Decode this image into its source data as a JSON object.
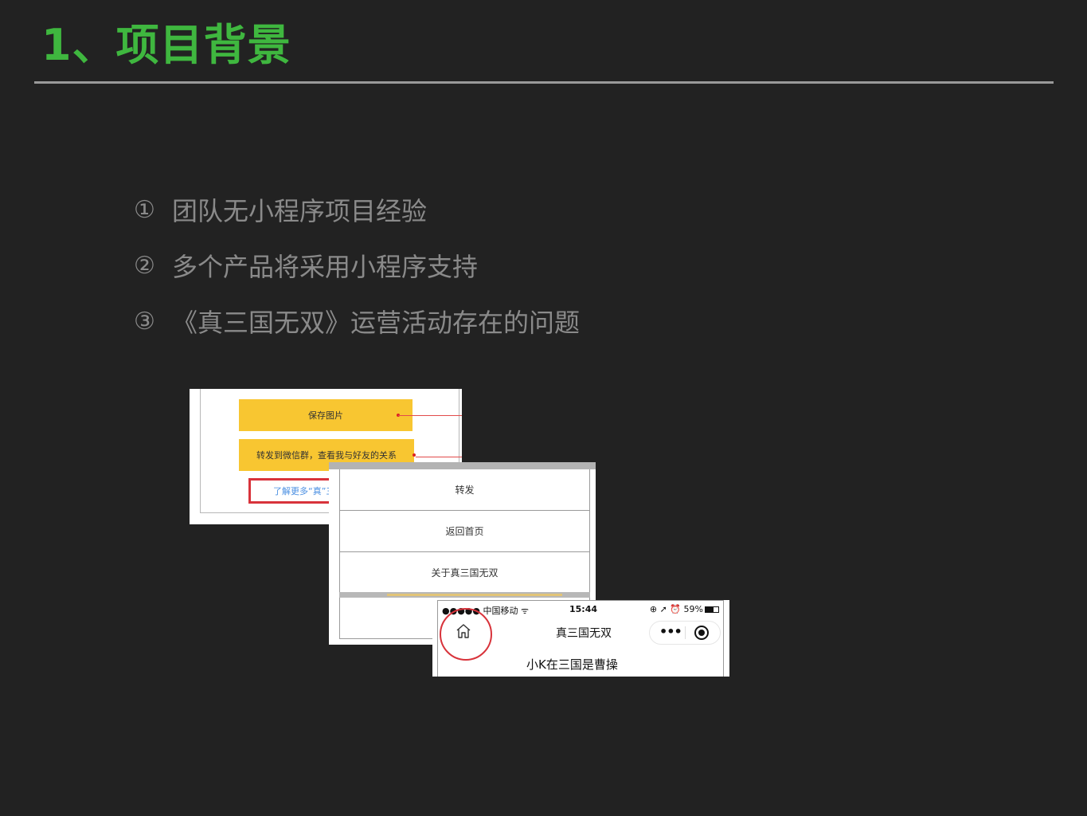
{
  "slide": {
    "title": "1、项目背景",
    "bullets": [
      {
        "num": "①",
        "text": "团队无小程序项目经验"
      },
      {
        "num": "②",
        "text": "多个产品将采用小程序支持"
      },
      {
        "num": "③",
        "text": "《真三国无双》运营活动存在的问题"
      }
    ]
  },
  "screenshot1": {
    "save_image": "保存图片",
    "share_group": "转发到微信群，查看我与好友的关系",
    "learn_more": "了解更多“真”三"
  },
  "screenshot2": {
    "menu": [
      "转发",
      "返回首页",
      "关于真三国无双"
    ]
  },
  "screenshot3": {
    "carrier": "●●●●● 中国移动 ᯤ",
    "time": "15:44",
    "status_right": "⊕ ➚ ⏰ 59%",
    "nav_title": "真三国无双",
    "page_heading": "小K在三国是曹操"
  },
  "colors": {
    "background": "#222222",
    "title_green": "#3fb73f",
    "bullet_gray": "#8a8a8a",
    "button_yellow": "#f8c631",
    "highlight_red": "#d8333b",
    "link_blue": "#4a8fe2"
  }
}
